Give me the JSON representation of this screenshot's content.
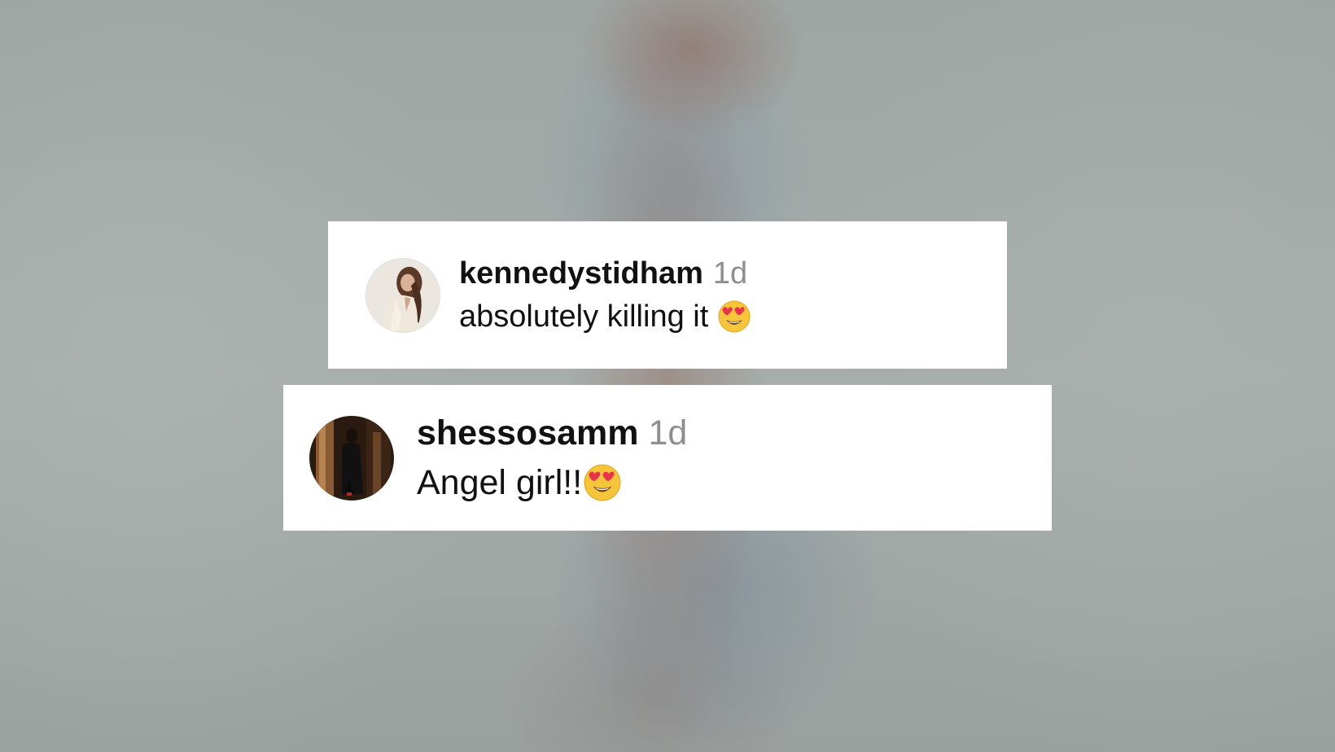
{
  "comments": [
    {
      "username": "kennedystidham",
      "time": "1d",
      "text": "absolutely killing it",
      "emoji": "heart-eyes-emoji",
      "avatar": "user-avatar-kennedystidham"
    },
    {
      "username": "shessosamm",
      "time": "1d",
      "text": "Angel girl!!",
      "emoji": "heart-eyes-emoji",
      "avatar": "user-avatar-shessosamm"
    }
  ],
  "colors": {
    "username": "#111111",
    "timestamp": "#8e8e8e",
    "card_background": "#ffffff",
    "emoji_face": "#f7c53a",
    "emoji_heart": "#e8334a"
  }
}
